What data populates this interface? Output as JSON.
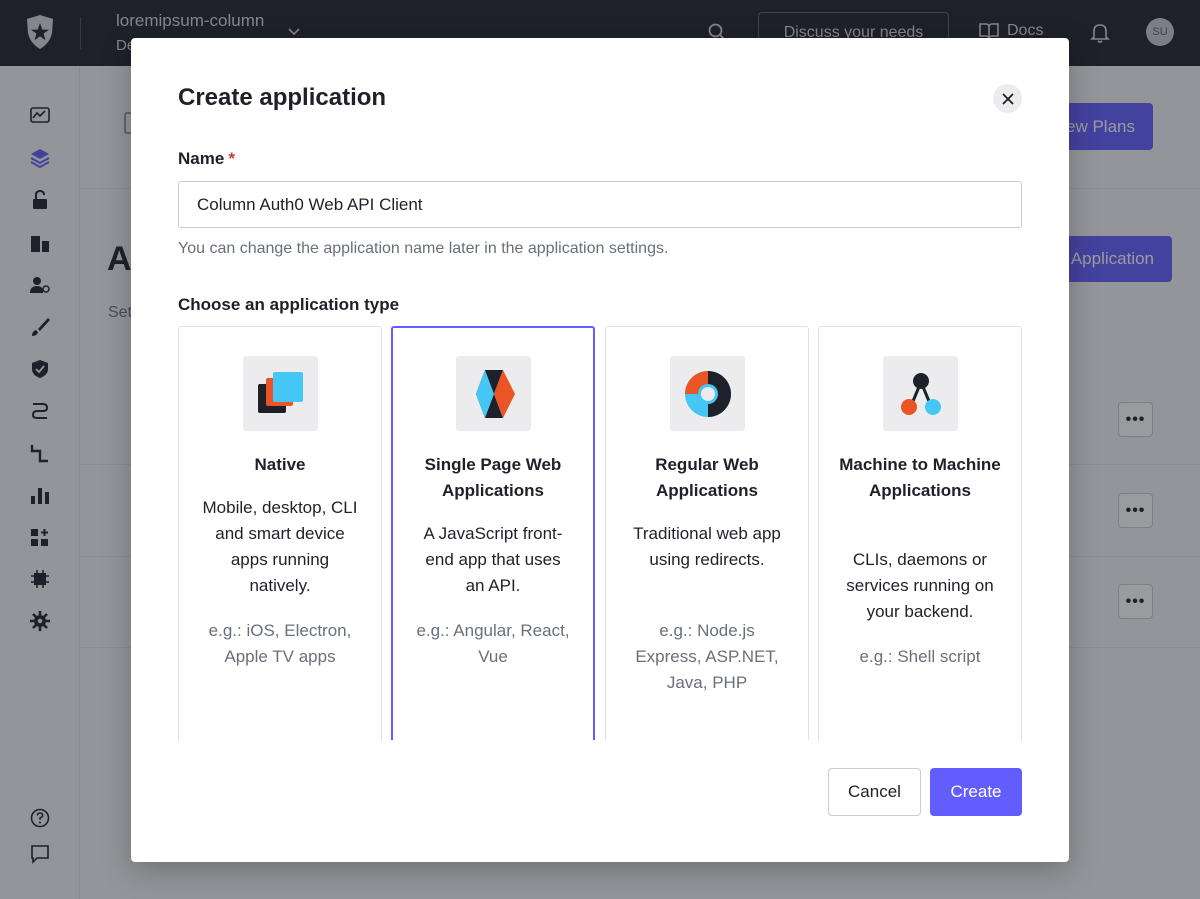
{
  "topbar": {
    "tenant_name": "loremipsum-column",
    "tenant_env": "De",
    "discuss_label": "Discuss your needs",
    "docs_label": "Docs",
    "avatar_initials": "SU"
  },
  "background": {
    "view_plans_label": "ew Plans",
    "page_title": "A",
    "page_subtitle": "Set",
    "create_application_label": "Application",
    "row_action_label": "•••"
  },
  "modal": {
    "title": "Create application",
    "name_label": "Name",
    "required_mark": "*",
    "name_value": "Column Auth0 Web API Client",
    "name_help": "You can change the application name later in the application settings.",
    "type_label": "Choose an application type",
    "cards": [
      {
        "title": "Native",
        "description": "Mobile, desktop, CLI and smart device apps running natively.",
        "example": "e.g.: iOS, Electron, Apple TV apps"
      },
      {
        "title": "Single Page Web Applications",
        "description": "A JavaScript front-end app that uses an API.",
        "example": "e.g.: Angular, React, Vue"
      },
      {
        "title": "Regular Web Applications",
        "description": "Traditional web app using redirects.",
        "example": "e.g.: Node.js Express, ASP.NET, Java, PHP"
      },
      {
        "title": "Machine to Machine Applications",
        "description": "CLIs, daemons or services running on your backend.",
        "example": "e.g.: Shell script"
      }
    ],
    "selected_card": "Single Page Web Applications",
    "cancel_label": "Cancel",
    "create_label": "Create"
  },
  "colors": {
    "primary": "#635dff",
    "topbar": "#1e212a",
    "required": "#d03c38"
  }
}
